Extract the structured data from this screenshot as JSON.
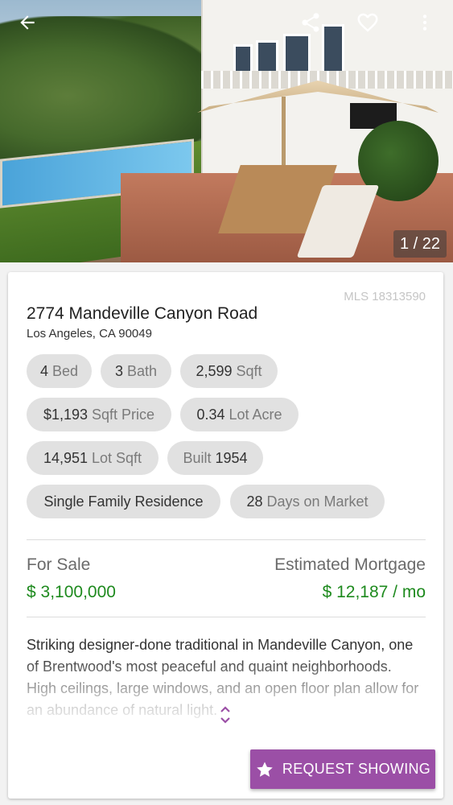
{
  "photo": {
    "counter": "1 / 22"
  },
  "topbar": {
    "icons": [
      "back-arrow-icon",
      "share-icon",
      "heart-icon",
      "more-vert-icon"
    ]
  },
  "listing": {
    "mls": "MLS 18313590",
    "address": "2774 Mandeville Canyon Road",
    "city_line": "Los Angeles, CA 90049",
    "chips": [
      {
        "value": "4",
        "unit": "Bed"
      },
      {
        "value": "3",
        "unit": "Bath"
      },
      {
        "value": "2,599",
        "unit": "Sqft"
      },
      {
        "value": "$1,193",
        "unit": "Sqft Price"
      },
      {
        "value": "0.34",
        "unit": "Lot Acre"
      },
      {
        "value": "14,951",
        "unit": "Lot Sqft"
      },
      {
        "lead": "Built",
        "value": "1954"
      },
      {
        "value": "Single Family Residence"
      },
      {
        "value": "28",
        "unit": "Days on Market"
      }
    ],
    "sale_label": "For Sale",
    "sale_price": "$ 3,100,000",
    "mortgage_label": "Estimated Mortgage",
    "mortgage_price": "$ 12,187 / mo",
    "description": "Striking designer-done traditional in Mandeville Canyon, one of Brentwood's most peaceful and quaint neighborhoods. High ceilings, large windows, and an open floor plan allow for an abundance of natural light."
  },
  "actions": {
    "request_label": "REQUEST SHOWING"
  },
  "colors": {
    "accent": "#9b4fa6",
    "price": "#1e8a1e",
    "chip_bg": "#e1e1e1"
  }
}
